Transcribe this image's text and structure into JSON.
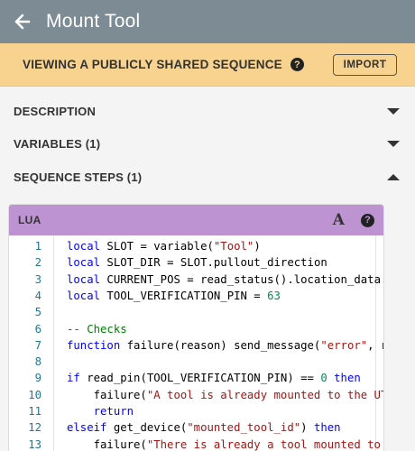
{
  "header": {
    "title": "Mount Tool",
    "back_icon": "arrow-left-icon"
  },
  "banner": {
    "text": "VIEWING A PUBLICLY SHARED SEQUENCE",
    "help_icon": "?",
    "import_label": "IMPORT"
  },
  "sections": {
    "description": "DESCRIPTION",
    "variables": "VARIABLES (1)",
    "steps": "SEQUENCE STEPS (1)"
  },
  "editor": {
    "language": "LUA",
    "font_icon": "A",
    "help_icon": "?",
    "lines": [
      {
        "n": "1",
        "parts": [
          {
            "c": "kw",
            "t": "local"
          },
          {
            "c": "",
            "t": " SLOT = variable("
          },
          {
            "c": "str",
            "t": "\"Tool\""
          },
          {
            "c": "",
            "t": ")"
          }
        ]
      },
      {
        "n": "2",
        "parts": [
          {
            "c": "kw",
            "t": "local"
          },
          {
            "c": "",
            "t": " SLOT_DIR = SLOT.pullout_direction"
          }
        ]
      },
      {
        "n": "3",
        "parts": [
          {
            "c": "kw",
            "t": "local"
          },
          {
            "c": "",
            "t": " CURRENT_POS = read_status().location_data."
          }
        ]
      },
      {
        "n": "4",
        "parts": [
          {
            "c": "kw",
            "t": "local"
          },
          {
            "c": "",
            "t": " TOOL_VERIFICATION_PIN = "
          },
          {
            "c": "num",
            "t": "63"
          }
        ]
      },
      {
        "n": "5",
        "parts": []
      },
      {
        "n": "6",
        "parts": [
          {
            "c": "cmt",
            "t": "-- Checks"
          }
        ]
      },
      {
        "n": "7",
        "parts": [
          {
            "c": "kw",
            "t": "function"
          },
          {
            "c": "",
            "t": " failure(reason) send_message("
          },
          {
            "c": "str",
            "t": "\"error\""
          },
          {
            "c": "",
            "t": ", r"
          }
        ]
      },
      {
        "n": "8",
        "parts": []
      },
      {
        "n": "9",
        "parts": [
          {
            "c": "kw",
            "t": "if"
          },
          {
            "c": "",
            "t": " read_pin(TOOL_VERIFICATION_PIN) == "
          },
          {
            "c": "num",
            "t": "0"
          },
          {
            "c": "",
            "t": " "
          },
          {
            "c": "kw",
            "t": "then"
          }
        ]
      },
      {
        "n": "10",
        "parts": [
          {
            "c": "",
            "t": "    failure("
          },
          {
            "c": "str",
            "t": "\"A tool is already mounted to the UT"
          }
        ]
      },
      {
        "n": "11",
        "parts": [
          {
            "c": "",
            "t": "    "
          },
          {
            "c": "kw",
            "t": "return"
          }
        ]
      },
      {
        "n": "12",
        "parts": [
          {
            "c": "kw",
            "t": "elseif"
          },
          {
            "c": "",
            "t": " get_device("
          },
          {
            "c": "str",
            "t": "\"mounted_tool_id\""
          },
          {
            "c": "",
            "t": ") "
          },
          {
            "c": "kw",
            "t": "then"
          }
        ]
      },
      {
        "n": "13",
        "parts": [
          {
            "c": "",
            "t": "    failure("
          },
          {
            "c": "str",
            "t": "\"There is already a tool mounted to"
          }
        ]
      }
    ]
  }
}
